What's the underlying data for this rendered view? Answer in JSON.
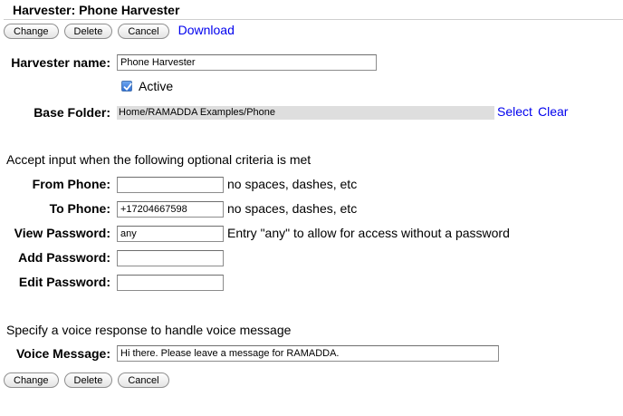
{
  "header": {
    "title": "Harvester: Phone Harvester"
  },
  "top_buttons": {
    "change": "Change",
    "delete": "Delete",
    "cancel": "Cancel",
    "download": "Download"
  },
  "form": {
    "name_label": "Harvester name:",
    "name_value": "Phone Harvester",
    "active_label": "Active",
    "active_checked": true,
    "folder_label": "Base Folder:",
    "folder_value": "Home/RAMADDA Examples/Phone",
    "select_link": "Select",
    "clear_link": "Clear"
  },
  "criteria": {
    "intro": "Accept input when the following optional criteria is met",
    "from_phone_label": "From Phone:",
    "from_phone_value": "",
    "from_phone_hint": "no spaces, dashes, etc",
    "to_phone_label": "To Phone:",
    "to_phone_value": "+17204667598",
    "to_phone_hint": "no spaces, dashes, etc",
    "view_password_label": "View Password:",
    "view_password_value": "any",
    "view_password_hint": "Entry \"any\" to allow for access without a password",
    "add_password_label": "Add Password:",
    "add_password_value": "",
    "edit_password_label": "Edit Password:",
    "edit_password_value": ""
  },
  "voice": {
    "intro": "Specify a voice response to handle voice message",
    "label": "Voice Message:",
    "value": "Hi there. Please leave a message for RAMADDA."
  },
  "bottom_buttons": {
    "change": "Change",
    "delete": "Delete",
    "cancel": "Cancel"
  }
}
